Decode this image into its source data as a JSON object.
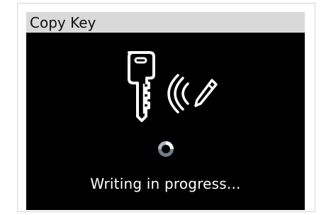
{
  "window": {
    "title": "Copy Key"
  },
  "screen": {
    "status_text": "Writing in progress...",
    "colors": {
      "background": "#000000",
      "title_bar": "#d9d9d9",
      "title_text": "#111111",
      "status_text": "#ffffff",
      "icon_stroke": "#ffffff",
      "spinner": "#6f7f8f"
    }
  },
  "icons": {
    "key": "key-icon",
    "signal": "signal-waves-icon",
    "pencil": "pencil-icon",
    "spinner": "loading-spinner-icon"
  }
}
